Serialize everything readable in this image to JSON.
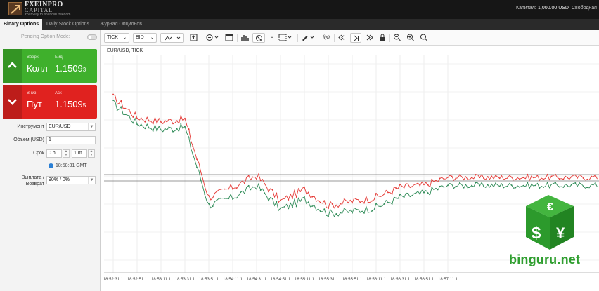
{
  "header": {
    "logo_name": "FXEINPRO",
    "logo_name2": "CAPITAL",
    "logo_tagline": "Your way to financial freedom",
    "capital_label": "Капитал:",
    "capital_value": "1,000.00 USD",
    "free_label": "Свободная"
  },
  "tabs": [
    {
      "label": "Binary Options",
      "active": true
    },
    {
      "label": "Daily Stock Options",
      "active": false
    },
    {
      "label": "Журнал Опционов",
      "active": false
    }
  ],
  "left_panel": {
    "pending_label": "Pending Option Mode:",
    "call": {
      "direction": "Вверх",
      "action": "Колл",
      "price_label": "Бид",
      "price_main": "1.1509",
      "price_small": "3",
      "color": "#3fb02c"
    },
    "put": {
      "direction": "Вниз",
      "action": "Пут",
      "price_label": "Аск",
      "price_main": "1.1509",
      "price_small": "5",
      "color": "#e0221f"
    },
    "instrument_label": "Инструмент",
    "instrument_value": "EUR/USD",
    "volume_label": "Объем (USD)",
    "volume_value": "1",
    "term_label": "Срок",
    "term_hours": "0 h",
    "term_minutes": "1 m",
    "gmt_time": "18:58:31 GMT",
    "payout_label_1": "Выплата /",
    "payout_label_2": "Возврат",
    "payout_value": "90% / 0%"
  },
  "toolbar": {
    "tick_label": "TICK",
    "bid_label": "BID",
    "icons": [
      "line-chart-icon",
      "save-icon",
      "minus-circle-icon",
      "panel-icon",
      "bars-icon",
      "hide-icon",
      "layout-icon",
      "pencil-icon",
      "function-icon",
      "rewind-icon",
      "step-forward-icon",
      "fast-forward-icon",
      "lock-icon",
      "zoom-out-icon",
      "zoom-in-icon",
      "zoom-reset-icon"
    ]
  },
  "chart": {
    "title": "EUR/USD, TICK",
    "x_ticks": [
      "18:52:31.1",
      "18:52:51.1",
      "18:53:11.1",
      "18:53:31.1",
      "18:53:51.1",
      "18:54:11.1",
      "18:54:31.1",
      "18:54:51.1",
      "18:55:11.1",
      "18:55:31.1",
      "18:55:51.1",
      "18:56:11.1",
      "18:56:31.1",
      "18:56:51.1",
      "18:57:11.1"
    ],
    "colors": {
      "ask": "#e53935",
      "bid": "#2e8b57"
    }
  },
  "chart_data": {
    "type": "line",
    "title": "EUR/USD, TICK",
    "x": [
      "18:52:31.1",
      "18:52:51.1",
      "18:53:11.1",
      "18:53:31.1",
      "18:53:51.1",
      "18:54:11.1",
      "18:54:31.1",
      "18:54:51.1",
      "18:55:11.1",
      "18:55:31.1",
      "18:55:51.1",
      "18:56:11.1",
      "18:56:31.1",
      "18:56:51.1",
      "18:57:11.1"
    ],
    "series": [
      {
        "name": "Ask",
        "values": [
          0.86,
          0.76,
          0.74,
          0.75,
          0.36,
          0.41,
          0.47,
          0.34,
          0.4,
          0.32,
          0.34,
          0.36,
          0.41,
          0.42,
          0.46
        ]
      },
      {
        "name": "Bid",
        "values": [
          0.83,
          0.73,
          0.7,
          0.71,
          0.32,
          0.36,
          0.42,
          0.3,
          0.35,
          0.28,
          0.29,
          0.31,
          0.36,
          0.38,
          0.42
        ]
      }
    ],
    "grid": true
  },
  "watermark": {
    "text": "binguru.net"
  }
}
